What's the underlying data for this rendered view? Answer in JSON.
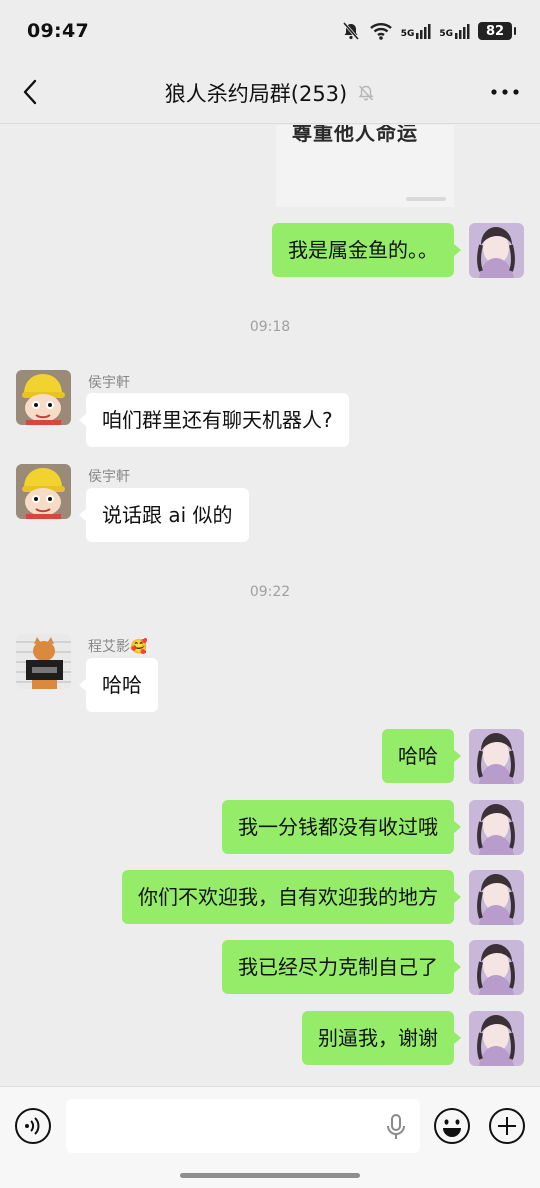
{
  "status_bar": {
    "time": "09:47",
    "battery": "82",
    "signal1": "5G",
    "signal2": "5G"
  },
  "header": {
    "title": "狼人杀约局群(253)"
  },
  "chat": {
    "image_card_text": "尊重他人命运",
    "messages": [
      {
        "text": "我是属金鱼的。。"
      },
      {
        "timestamp": "09:18"
      },
      {
        "sender": "侯宇軒",
        "text": "咱们群里还有聊天机器人?"
      },
      {
        "sender": "侯宇軒",
        "text": "说话跟 ai 似的"
      },
      {
        "timestamp": "09:22"
      },
      {
        "sender": "程艾影🥰",
        "text": "哈哈"
      },
      {
        "text": "哈哈"
      },
      {
        "text": "我一分钱都没有收过哦"
      },
      {
        "text": "你们不欢迎我，自有欢迎我的地方"
      },
      {
        "text": "我已经尽力克制自己了"
      },
      {
        "text": "别逼我，谢谢"
      }
    ]
  },
  "colors": {
    "outgoing_bubble": "#95ec69",
    "incoming_bubble": "#ffffff",
    "background": "#ededed"
  }
}
